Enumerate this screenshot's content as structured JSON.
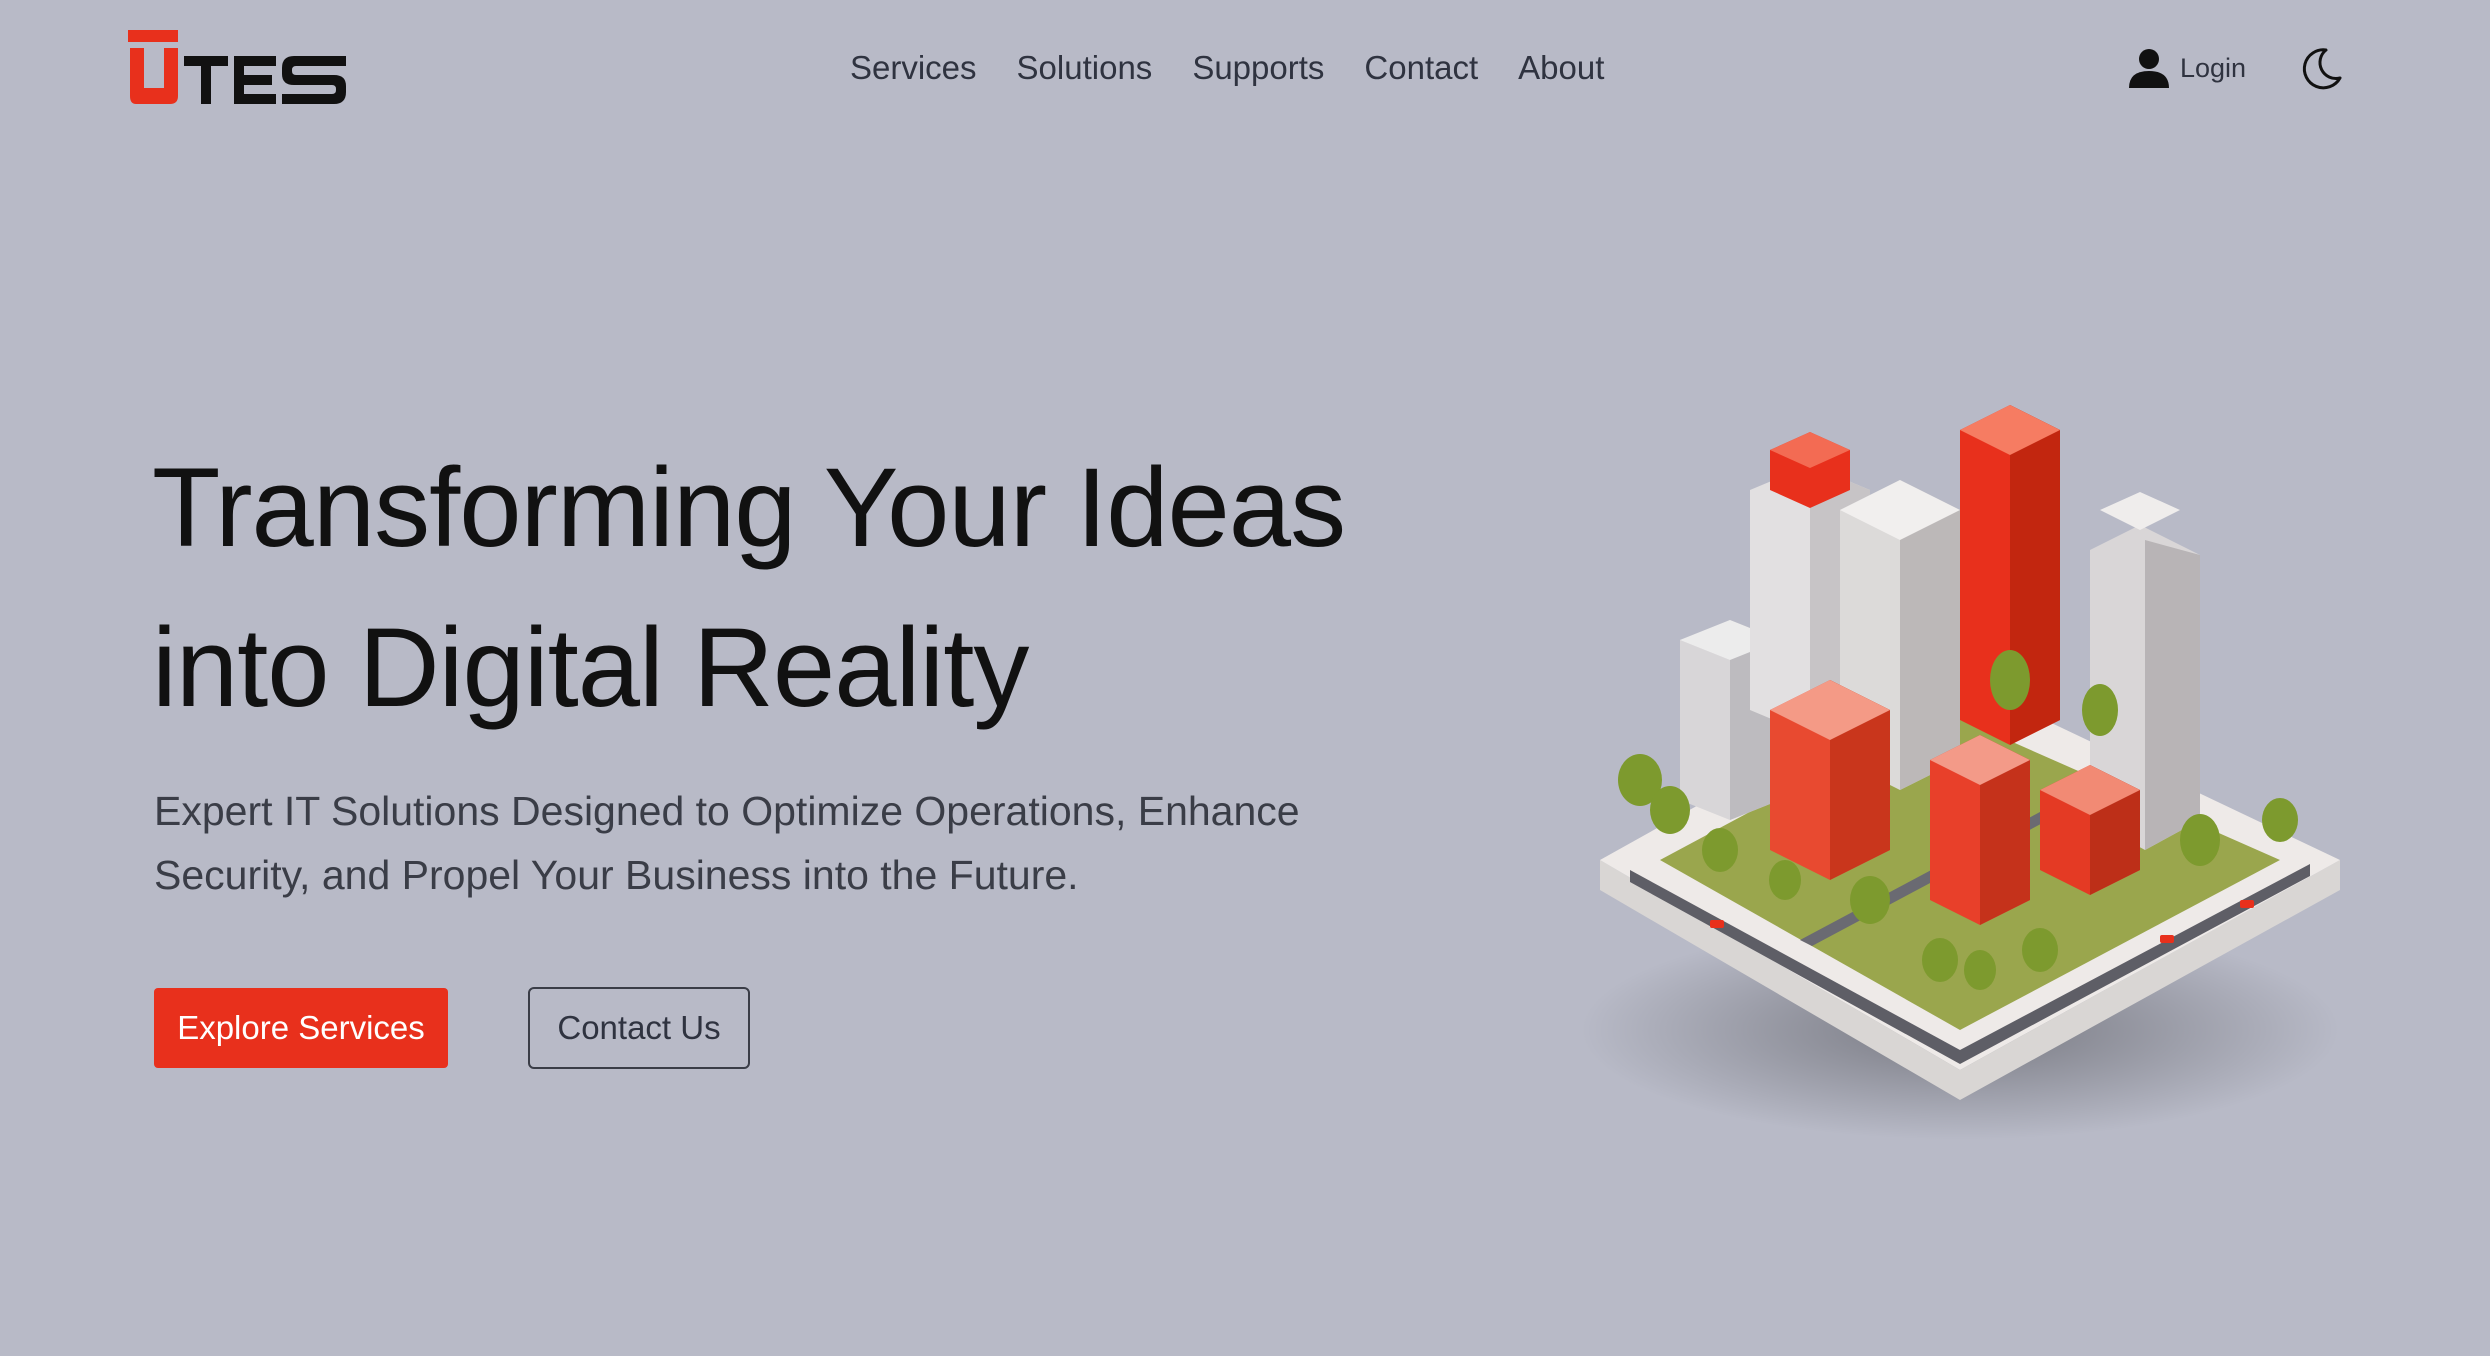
{
  "brand": {
    "name": "UTES",
    "accent_color": "#e8301c"
  },
  "nav": {
    "items": [
      {
        "label": "Services"
      },
      {
        "label": "Solutions"
      },
      {
        "label": "Supports"
      },
      {
        "label": "Contact"
      },
      {
        "label": "About"
      }
    ]
  },
  "header": {
    "login_label": "Login",
    "login_icon": "user-icon",
    "theme_icon": "moon-icon"
  },
  "hero": {
    "title_line1": "Transforming Your Ideas",
    "title_line2": "into Digital Reality",
    "subtitle_line1": "Expert IT Solutions Designed to Optimize Operations, Enhance",
    "subtitle_line2": "Security, and Propel Your Business into the Future.",
    "primary_button": "Explore Services",
    "secondary_button": "Contact Us"
  },
  "colors": {
    "background": "#b8bac7",
    "text": "#111111",
    "primary": "#e8301c"
  }
}
